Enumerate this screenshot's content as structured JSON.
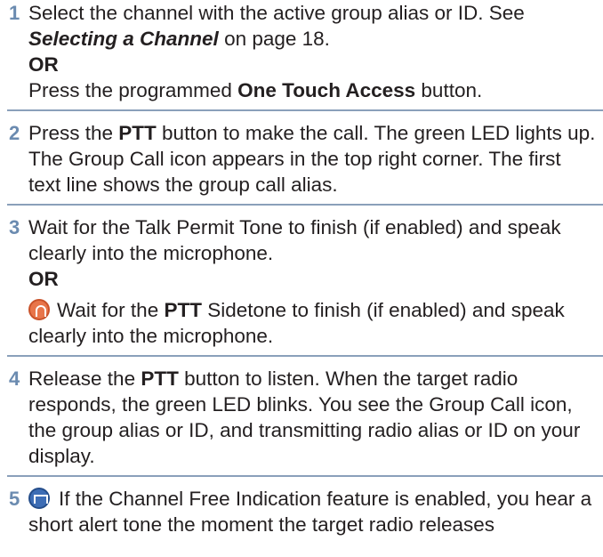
{
  "steps": [
    {
      "number": "1",
      "line1": "Select the channel with the active group alias or ID. See",
      "ref_title": "Selecting a Channel",
      "ref_rest": " on page 18.",
      "or_label": "OR",
      "alt_pre": "Press the programmed ",
      "alt_bold": "One Touch Access",
      "alt_post": " button."
    },
    {
      "number": "2",
      "pre": "Press the ",
      "bold": "PTT",
      "post": " button to make the call. The green LED lights up. The Group Call icon appears in the top right corner. The first text line shows the group call alias."
    },
    {
      "number": "3",
      "text": "Wait for the Talk Permit Tone to finish (if enabled) and speak clearly into the microphone.",
      "or_label": "OR",
      "icon": "sidetone-icon",
      "alt_pre": "Wait for the ",
      "alt_bold": "PTT",
      "alt_post": " Sidetone to finish (if enabled) and speak clearly into the microphone."
    },
    {
      "number": "4",
      "pre": "Release the ",
      "bold": "PTT",
      "post": " button to listen. When the target radio responds, the green LED blinks. You see the Group Call icon, the group alias or ID, and transmitting radio alias or ID on your display."
    },
    {
      "number": "5",
      "icon": "channel-free-indication-icon",
      "text": "If the Channel Free Indication feature is enabled, you hear a short alert tone the moment the target radio releases"
    }
  ],
  "colors": {
    "step_number": "#6b8bb0",
    "divider": "#8aa0ba",
    "text": "#231f20",
    "sidetone_icon": "#e8754a",
    "cfi_icon": "#3d6db5"
  }
}
